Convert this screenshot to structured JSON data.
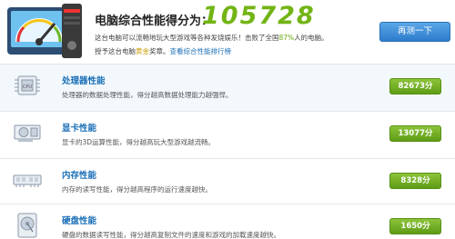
{
  "header": {
    "title": "电脑综合性能得分为：",
    "score": "105728",
    "desc_line1_a": "这台电脑可以流畅地玩大型游戏等各种发烧娱乐！击败了全国",
    "desc_line1_pct": "87%",
    "desc_line1_b": "人的电脑。",
    "desc_line2_a": "授予这台电脑",
    "desc_line2_award": "黄金",
    "desc_line2_b": "奖章。",
    "desc_line2_link": "查看综合性能排行榜",
    "reeval_button": "再测一下"
  },
  "rows": [
    {
      "title": "处理器性能",
      "desc": "处理器的数据处理性能，得分越高数据处理能力越强悍。",
      "score": "82673分",
      "icon": "cpu-icon"
    },
    {
      "title": "显卡性能",
      "desc": "显卡的3D运算性能，得分越高玩大型游戏越流畅。",
      "score": "13077分",
      "icon": "graphics-card-icon"
    },
    {
      "title": "内存性能",
      "desc": "内存的读写性能，得分越高程序的运行速度越快。",
      "score": "8328分",
      "icon": "memory-icon"
    },
    {
      "title": "硬盘性能",
      "desc": "硬盘的数据读写性能，得分越高复制文件的速度和游戏的加载速度越快。",
      "score": "1650分",
      "icon": "hard-disk-icon"
    }
  ],
  "colors": {
    "score_green": "#72b414",
    "title_blue": "#1a6fb7",
    "badge_green": "#6aa81f"
  }
}
